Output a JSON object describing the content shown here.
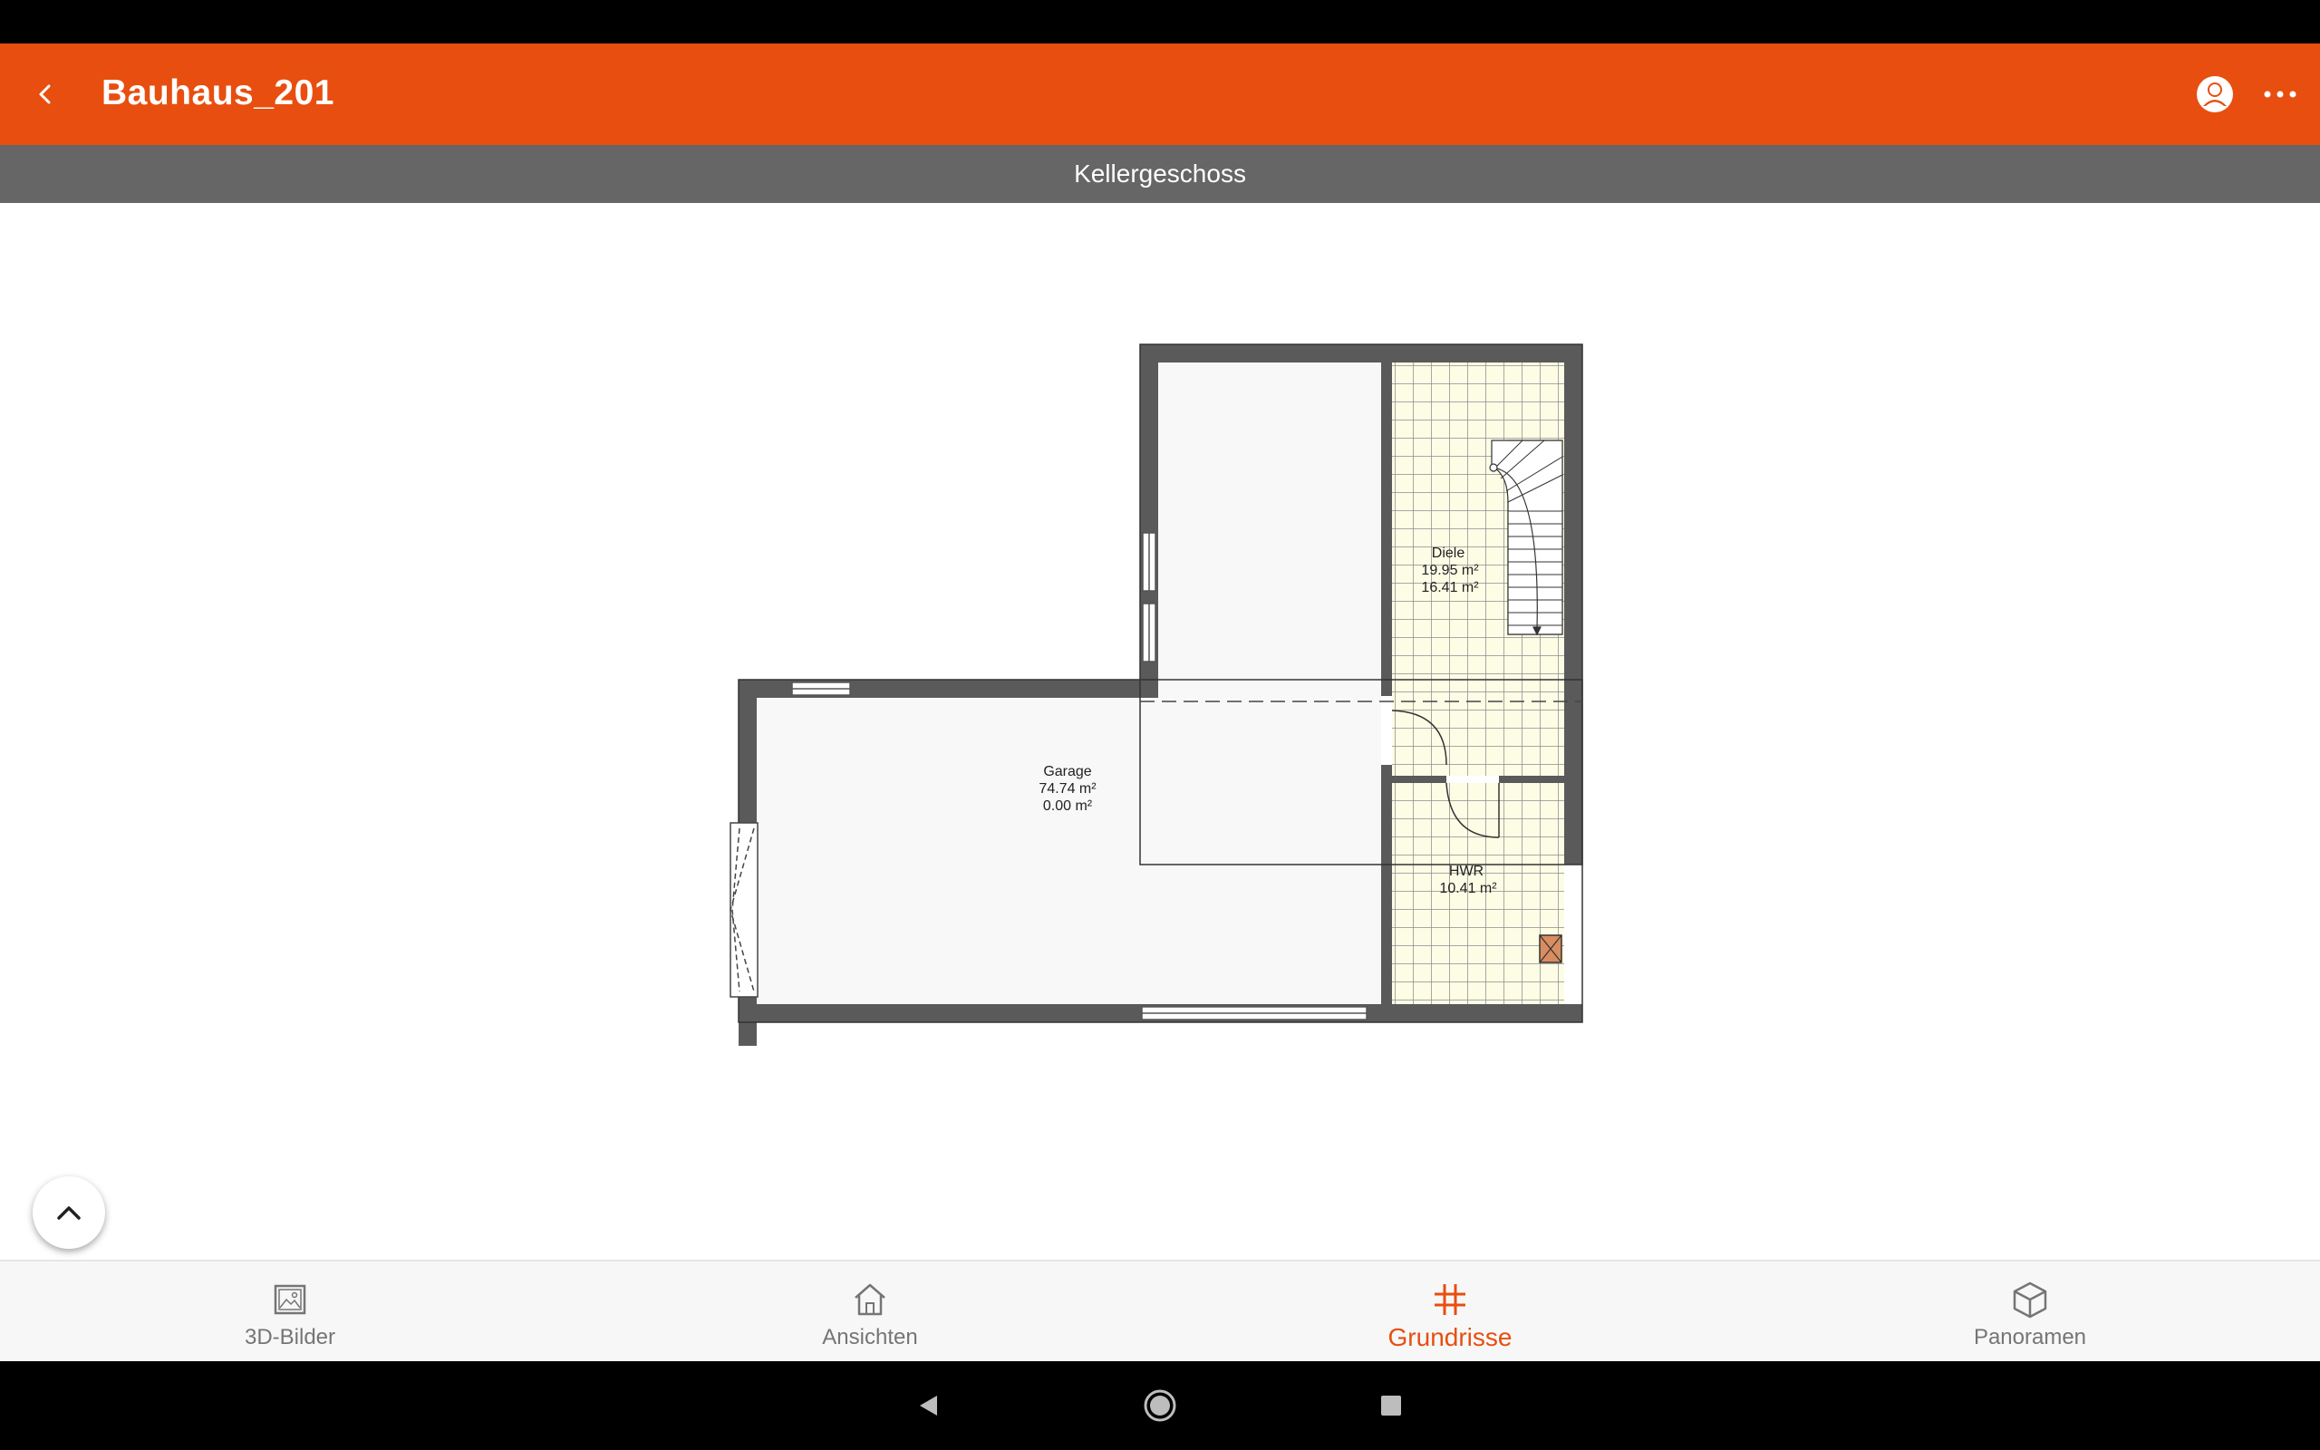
{
  "app_bar": {
    "title": "Bauhaus_201",
    "back_icon": "chevron-left-icon",
    "profile_icon": "account-circle-icon",
    "more_icon": "more-horizontal-icon"
  },
  "floor": {
    "name": "Kellergeschoss"
  },
  "floor_plan": {
    "rooms": [
      {
        "name": "Garage",
        "area_1": "74.74 m²",
        "area_2": "0.00 m²"
      },
      {
        "name": "Diele",
        "area_1": "19.95 m²",
        "area_2": "16.41 m²"
      },
      {
        "name": "HWR",
        "area_1": "10.41 m²"
      }
    ]
  },
  "fab": {
    "icon": "chevron-up-icon"
  },
  "bottom_nav": {
    "items": [
      {
        "label": "3D-Bilder",
        "icon": "image-icon",
        "active": false
      },
      {
        "label": "Ansichten",
        "icon": "house-icon",
        "active": false
      },
      {
        "label": "Grundrisse",
        "icon": "grid-hash-icon",
        "active": true
      },
      {
        "label": "Panoramen",
        "icon": "cube-icon",
        "active": false
      }
    ]
  },
  "system_nav": {
    "back": "triangle-back-icon",
    "home": "circle-home-icon",
    "recents": "square-recents-icon"
  },
  "colors": {
    "accent": "#e84e0f",
    "floor_bar": "#666666",
    "wall": "#5a5a5a",
    "tile": "#fdfde6",
    "tile_grid": "#999999"
  }
}
